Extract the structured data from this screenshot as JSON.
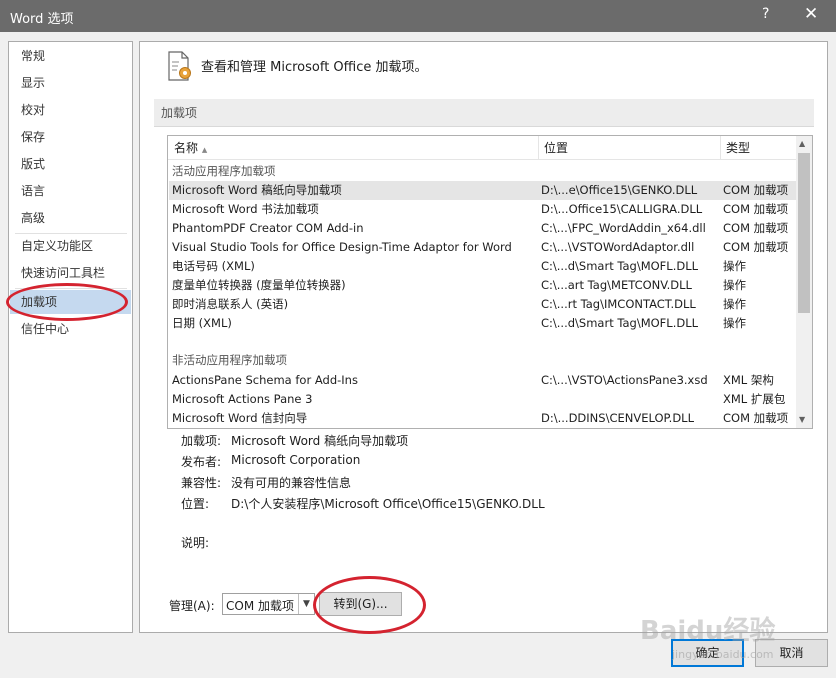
{
  "window": {
    "title": "Word 选项",
    "help": "?",
    "close": "✕"
  },
  "sidebar": {
    "items": [
      {
        "label": "常规"
      },
      {
        "label": "显示"
      },
      {
        "label": "校对"
      },
      {
        "label": "保存"
      },
      {
        "label": "版式"
      },
      {
        "label": "语言"
      },
      {
        "label": "高级"
      },
      {
        "label": "自定义功能区"
      },
      {
        "label": "快速访问工具栏"
      },
      {
        "label": "加载项",
        "selected": true
      },
      {
        "label": "信任中心"
      }
    ]
  },
  "header": {
    "icon": "addin-gear-icon",
    "title": "查看和管理 Microsoft Office 加载项。"
  },
  "addins_section": {
    "label": "加载项"
  },
  "table": {
    "columns": {
      "name": "名称",
      "sort": "▲",
      "location": "位置",
      "type": "类型"
    },
    "active_group": "活动应用程序加载项",
    "inactive_group": "非活动应用程序加载项",
    "active_rows": [
      {
        "name": "Microsoft Word 稿纸向导加载项",
        "location": "D:\\...e\\Office15\\GENKO.DLL",
        "type": "COM 加载项",
        "selected": true
      },
      {
        "name": "Microsoft Word 书法加载项",
        "location": "D:\\...Office15\\CALLIGRA.DLL",
        "type": "COM 加载项"
      },
      {
        "name": "PhantomPDF Creator COM Add-in",
        "location": "C:\\...\\FPC_WordAddin_x64.dll",
        "type": "COM 加载项"
      },
      {
        "name": "Visual Studio Tools for Office Design-Time Adaptor for Word",
        "location": "C:\\...\\VSTOWordAdaptor.dll",
        "type": "COM 加载项"
      },
      {
        "name": "电话号码 (XML)",
        "location": "C:\\...d\\Smart Tag\\MOFL.DLL",
        "type": "操作"
      },
      {
        "name": "度量单位转换器 (度量单位转换器)",
        "location": "C:\\...art Tag\\METCONV.DLL",
        "type": "操作"
      },
      {
        "name": "即时消息联系人 (英语)",
        "location": "C:\\...rt Tag\\IMCONTACT.DLL",
        "type": "操作"
      },
      {
        "name": "日期 (XML)",
        "location": "C:\\...d\\Smart Tag\\MOFL.DLL",
        "type": "操作"
      }
    ],
    "inactive_rows": [
      {
        "name": "ActionsPane Schema for Add-Ins",
        "location": "C:\\...\\VSTO\\ActionsPane3.xsd",
        "type": "XML 架构"
      },
      {
        "name": "Microsoft Actions Pane 3",
        "location": "",
        "type": "XML 扩展包"
      },
      {
        "name": "Microsoft Word 信封向导",
        "location": "D:\\...DDINS\\CENVELOP.DLL",
        "type": "COM 加载项"
      }
    ]
  },
  "details": {
    "addin_label": "加载项:",
    "addin_value": "Microsoft Word 稿纸向导加载项",
    "publisher_label": "发布者:",
    "publisher_value": "Microsoft Corporation",
    "compat_label": "兼容性:",
    "compat_value": "没有可用的兼容性信息",
    "location_label": "位置:",
    "location_value": "D:\\个人安装程序\\Microsoft Office\\Office15\\GENKO.DLL",
    "desc_label": "说明:"
  },
  "manage": {
    "label": "管理(A):",
    "selected": "COM 加载项",
    "goto": "转到(G)..."
  },
  "footer": {
    "ok": "确定",
    "cancel": "取消"
  },
  "watermark": {
    "text": "Baidu经验",
    "sub": "jingyan.baidu.com"
  },
  "colors": {
    "titlebar": "#6b6b6b",
    "selected_nav": "#c5d9ef",
    "annotation": "#d4232f",
    "primary_border": "#0078d7"
  }
}
